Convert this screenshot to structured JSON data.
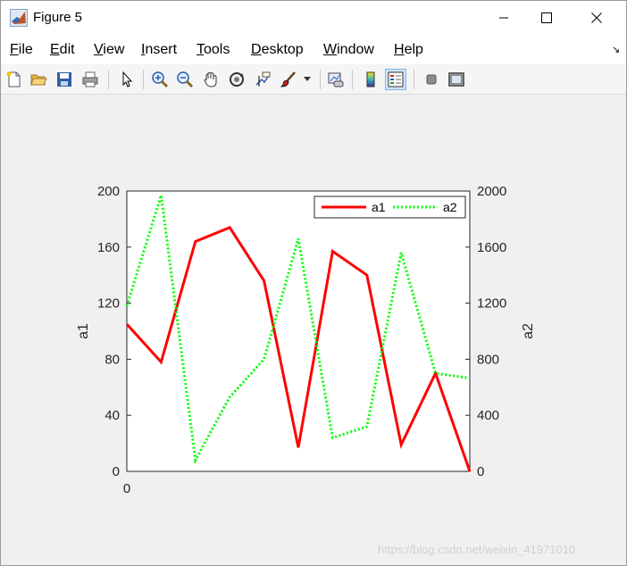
{
  "window": {
    "title": "Figure 5"
  },
  "menu": {
    "items": [
      {
        "pre": "",
        "ul": "F",
        "post": "ile"
      },
      {
        "pre": "",
        "ul": "E",
        "post": "dit"
      },
      {
        "pre": "",
        "ul": "V",
        "post": "iew"
      },
      {
        "pre": "",
        "ul": "I",
        "post": "nsert"
      },
      {
        "pre": "",
        "ul": "T",
        "post": "ools"
      },
      {
        "pre": "",
        "ul": "D",
        "post": "esktop"
      },
      {
        "pre": "",
        "ul": "W",
        "post": "indow"
      },
      {
        "pre": "",
        "ul": "H",
        "post": "elp"
      }
    ]
  },
  "toolbar": {
    "icons": [
      "new-figure-icon",
      "open-file-icon",
      "save-icon",
      "print-icon",
      "pointer-icon",
      "zoom-in-icon",
      "zoom-out-icon",
      "pan-icon",
      "rotate-3d-icon",
      "data-cursor-icon",
      "brush-icon",
      "brush-dropdown-icon",
      "link-plot-icon",
      "colorbar-icon",
      "legend-icon",
      "hide-plot-tools-icon",
      "show-plot-tools-icon"
    ],
    "active": "legend-icon"
  },
  "chart_data": {
    "type": "line",
    "x": [
      0,
      1,
      2,
      3,
      4,
      5,
      6,
      7,
      8,
      9,
      10
    ],
    "xlim": [
      0,
      10
    ],
    "x_tick_labels": [
      "0"
    ],
    "series": [
      {
        "name": "a1",
        "axis": "left",
        "color": "#ff0000",
        "style": "solid",
        "values": [
          105,
          78,
          164,
          174,
          136,
          17,
          157,
          140,
          19,
          70,
          0
        ]
      },
      {
        "name": "a2",
        "axis": "right",
        "color": "#00ff00",
        "style": "dotted",
        "values": [
          1180,
          1970,
          80,
          530,
          800,
          1660,
          240,
          320,
          1560,
          700,
          665
        ]
      }
    ],
    "ylabel": "a1",
    "ylim": [
      0,
      200
    ],
    "y_ticks": [
      "0",
      "40",
      "80",
      "120",
      "160",
      "200"
    ],
    "y2label": "a2",
    "y2lim": [
      0,
      2000
    ],
    "y2_ticks": [
      "0",
      "400",
      "800",
      "1200",
      "1600",
      "2000"
    ],
    "legend": "top-right",
    "grid": false
  },
  "watermark": "https://blog.csdn.net/weixin_41971010"
}
